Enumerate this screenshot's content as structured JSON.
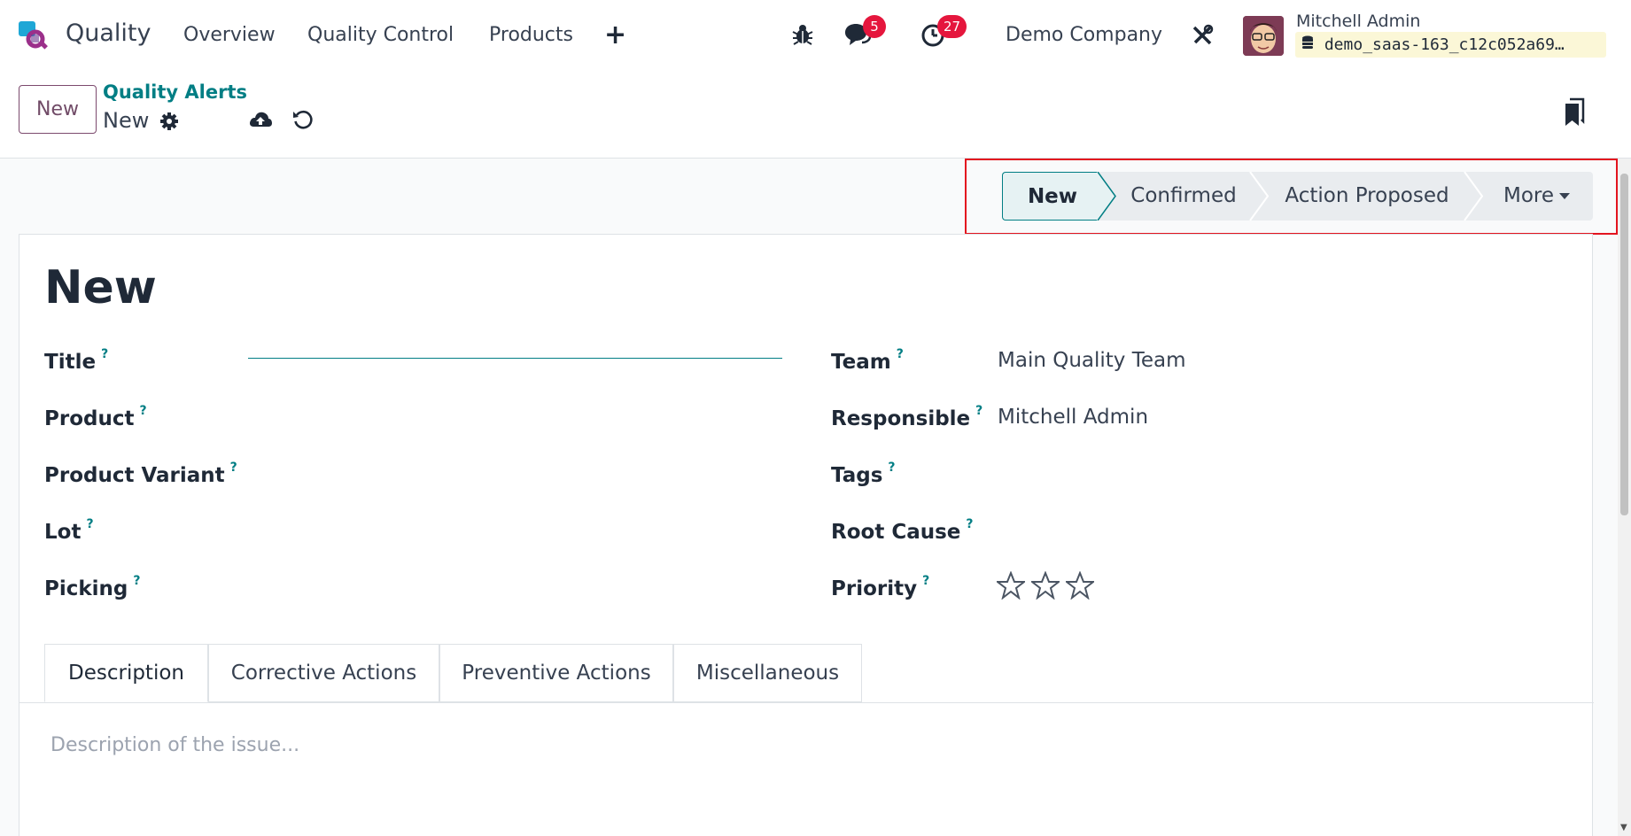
{
  "navbar": {
    "app_name": "Quality",
    "menu": [
      "Overview",
      "Quality Control",
      "Products"
    ],
    "plus_icon": "+",
    "chat_count": "5",
    "activity_count": "27",
    "company": "Demo Company",
    "user_name": "Mitchell Admin",
    "database": "demo_saas-163_c12c052a69…"
  },
  "control": {
    "new_button": "New",
    "breadcrumb": "Quality Alerts",
    "record_name": "New"
  },
  "statusbar": {
    "stages": [
      "New",
      "Confirmed",
      "Action Proposed"
    ],
    "more_label": "More",
    "active_stage": "New"
  },
  "form": {
    "record_title": "New",
    "left_fields": [
      {
        "label": "Title",
        "help": "?"
      },
      {
        "label": "Product",
        "help": "?"
      },
      {
        "label": "Product Variant",
        "help": "?"
      },
      {
        "label": "Lot",
        "help": "?"
      },
      {
        "label": "Picking",
        "help": "?"
      }
    ],
    "right_fields": [
      {
        "label": "Team",
        "help": "?",
        "value": "Main Quality Team"
      },
      {
        "label": "Responsible",
        "help": "?",
        "value": "Mitchell Admin"
      },
      {
        "label": "Tags",
        "help": "?",
        "value": ""
      },
      {
        "label": "Root Cause",
        "help": "?",
        "value": ""
      },
      {
        "label": "Priority",
        "help": "?",
        "value": ""
      }
    ],
    "priority_stars": 0,
    "priority_max": 3
  },
  "tabs": [
    "Description",
    "Corrective Actions",
    "Preventive Actions",
    "Miscellaneous"
  ],
  "active_tab": "Description",
  "description_placeholder": "Description of the issue...",
  "colors": {
    "brand": "#714b67",
    "accent": "#017e84",
    "badge": "#e5163d",
    "highlight_box": "#e3141f"
  }
}
